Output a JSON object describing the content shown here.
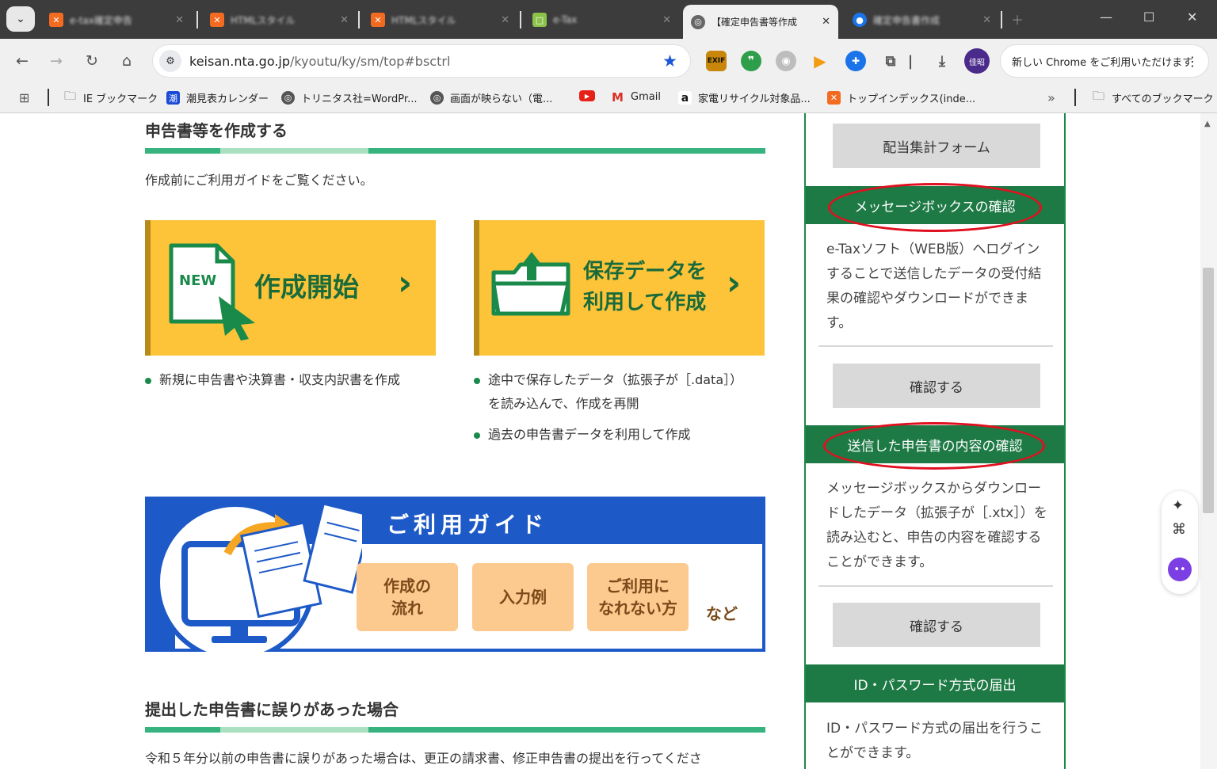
{
  "browser": {
    "tabs": [
      {
        "title": "e-tax確定申告",
        "favicon": "xampp-icon"
      },
      {
        "title": "HTMLスタイル",
        "favicon": "xampp-icon"
      },
      {
        "title": "HTMLスタイル",
        "favicon": "xampp-icon"
      },
      {
        "title": "e-Tax",
        "favicon": "green-icon"
      },
      {
        "title": "【確定申告書等作成",
        "favicon": "globe-icon",
        "active": true
      },
      {
        "title": "確定申告書作成",
        "favicon": "blue-icon"
      }
    ],
    "url_host": "keisan.nta.go.jp",
    "url_path": "/kyoutu/ky/sm/top#bsctrl",
    "profile_label": "佳昭",
    "new_chrome_label": "新しい Chrome をご利用いただけます",
    "exif_label": "EXIF",
    "bookmarks": [
      {
        "label": "IE ブックマーク",
        "icon": "folder-icon"
      },
      {
        "label": "潮見表カレンダー",
        "icon": "tide-icon",
        "glyph": "潮"
      },
      {
        "label": "トリニタス社=WordPr...",
        "icon": "globe-icon"
      },
      {
        "label": "画面が映らない（電...",
        "icon": "globe-icon"
      },
      {
        "label": "",
        "icon": "youtube-icon"
      },
      {
        "label": "Gmail",
        "icon": "gmail-icon"
      },
      {
        "label": "家電リサイクル対象品...",
        "icon": "amazon-icon",
        "glyph": "a"
      },
      {
        "label": "トップインデックス(inde...",
        "icon": "xampp-icon"
      }
    ],
    "all_bookmarks_label": "すべてのブックマーク"
  },
  "main": {
    "section1_title": "申告書等を作成する",
    "intro": "作成前にご利用ガイドをご覧ください。",
    "card_new": {
      "badge": "NEW",
      "label": "作成開始"
    },
    "card_saved": {
      "label_line1": "保存データを",
      "label_line2": "利用して作成"
    },
    "bullets_left": [
      "新規に申告書や決算書・収支内訳書を作成"
    ],
    "bullets_right": [
      "途中で保存したデータ（拡張子が［.data］）",
      "を読み込んで、作成を再開",
      "過去の申告書データを利用して作成"
    ],
    "guide": {
      "title": "ご利用ガイド",
      "buttons": [
        "作成の\n流れ",
        "入力例",
        "ご利用に\nなれない方"
      ],
      "more": "など"
    },
    "section2_title": "提出した申告書に誤りがあった場合",
    "section2_text": "令和５年分以前の申告書に誤りがあった場合は、更正の請求書、修正申告書の提出を行ってくださ"
  },
  "sidebar": {
    "button_dividend": "配当集計フォーム",
    "head_messagebox": "メッセージボックスの確認",
    "text_messagebox": "e-Taxソフト（WEB版）へログインすることで送信したデータの受付結果の確認やダウンロードができます。",
    "button_confirm1": "確認する",
    "head_sent": "送信した申告書の内容の確認",
    "text_sent": "メッセージボックスからダウンロードしたデータ（拡張子が［.xtx］）を読み込むと、申告の内容を確認することができます。",
    "button_confirm2": "確認する",
    "head_idpw": "ID・パスワード方式の届出",
    "text_idpw": "ID・パスワード方式の届出を行うことができます。"
  },
  "colors": {
    "accent_green": "#1e7a45",
    "card_yellow": "#fdc43a",
    "guide_blue": "#1d59c7",
    "annotation_red": "#e01020"
  }
}
